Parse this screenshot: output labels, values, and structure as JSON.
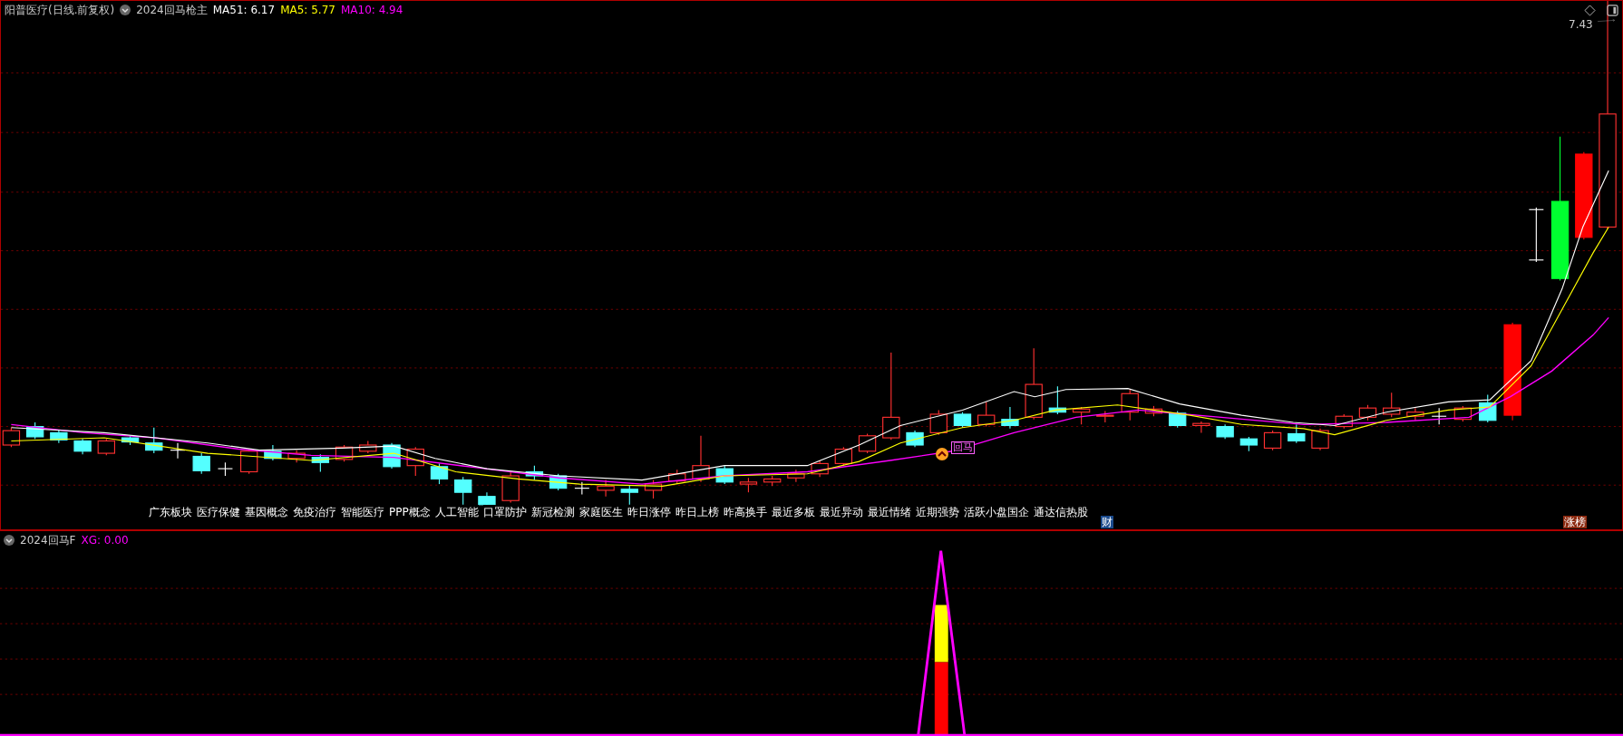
{
  "main_panel": {
    "stock_title": "阳普医疗(日线.前复权)",
    "indicator_name": "2024回马枪主",
    "ma_values": [
      {
        "label": "MA51: 6.17",
        "color": "#ffffff"
      },
      {
        "label": "MA5: 5.77",
        "color": "#ffff00"
      },
      {
        "label": "MA10: 4.94",
        "color": "#ff00ff"
      }
    ],
    "price_label": "7.43",
    "signal_label": "回马",
    "concept_tags": [
      "广东板块",
      "医疗保健",
      "基因概念",
      "免疫治疗",
      "智能医疗",
      "PPP概念",
      "人工智能",
      "口罩防护",
      "新冠检测",
      "家庭医生",
      "昨日涨停",
      "昨日上榜",
      "昨高换手",
      "最近多板",
      "最近异动",
      "最近情绪",
      "近期强势",
      "活跃小盘国企",
      "通达信热股"
    ],
    "badges": [
      {
        "text": "财",
        "color": "#1a4a8c"
      },
      {
        "text": "涨榜",
        "color": "#8c2a10"
      }
    ]
  },
  "sub_panel": {
    "indicator_name": "2024回马F",
    "value_label": "XG: 0.00"
  }
}
